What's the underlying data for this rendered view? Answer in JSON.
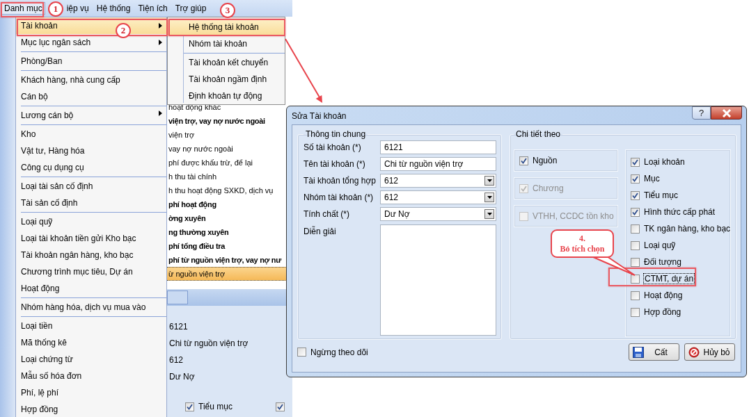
{
  "menubar": {
    "items": [
      {
        "label": "Danh mục",
        "selected": true
      },
      {
        "label": "iệp vụ",
        "selected": false
      },
      {
        "label": "Hệ thống",
        "selected": false
      },
      {
        "label": "Tiện ích",
        "selected": false
      },
      {
        "label": "Trợ giúp",
        "selected": false
      }
    ]
  },
  "menu": {
    "items": [
      {
        "label": "Tài khoản",
        "selected": true,
        "has_submenu": true,
        "separator_before": false
      },
      {
        "label": "Mục lục ngân sách",
        "selected": false,
        "has_submenu": true,
        "separator_before": false
      },
      {
        "label": "Phòng/Ban",
        "selected": false,
        "has_submenu": false,
        "separator_before": true
      },
      {
        "label": "Khách hàng, nhà cung cấp",
        "selected": false,
        "has_submenu": false,
        "separator_before": true
      },
      {
        "label": "Cán bộ",
        "selected": false,
        "has_submenu": false,
        "separator_before": false
      },
      {
        "label": "Lương cán bộ",
        "selected": false,
        "has_submenu": true,
        "separator_before": true
      },
      {
        "label": "Kho",
        "selected": false,
        "has_submenu": false,
        "separator_before": true
      },
      {
        "label": "Vật tư, Hàng hóa",
        "selected": false,
        "has_submenu": false,
        "separator_before": false
      },
      {
        "label": "Công cụ dụng cụ",
        "selected": false,
        "has_submenu": false,
        "separator_before": false
      },
      {
        "label": "Loại tài sản cố định",
        "selected": false,
        "has_submenu": false,
        "separator_before": true
      },
      {
        "label": "Tài sản cố định",
        "selected": false,
        "has_submenu": false,
        "separator_before": false
      },
      {
        "label": "Loại quỹ",
        "selected": false,
        "has_submenu": false,
        "separator_before": true
      },
      {
        "label": "Loại tài khoản tiền gửi Kho bạc",
        "selected": false,
        "has_submenu": false,
        "separator_before": false
      },
      {
        "label": "Tài khoản ngân hàng, kho bạc",
        "selected": false,
        "has_submenu": false,
        "separator_before": false
      },
      {
        "label": "Chương trình mục tiêu, Dự án",
        "selected": false,
        "has_submenu": false,
        "separator_before": false
      },
      {
        "label": "Hoạt động",
        "selected": false,
        "has_submenu": false,
        "separator_before": false
      },
      {
        "label": "Nhóm hàng hóa, dịch vụ mua vào",
        "selected": false,
        "has_submenu": false,
        "separator_before": true
      },
      {
        "label": "Loại tiền",
        "selected": false,
        "has_submenu": false,
        "separator_before": true
      },
      {
        "label": "Mã thống kê",
        "selected": false,
        "has_submenu": false,
        "separator_before": false
      },
      {
        "label": "Loại chứng từ",
        "selected": false,
        "has_submenu": false,
        "separator_before": false
      },
      {
        "label": "Mẫu số hóa đơn",
        "selected": false,
        "has_submenu": false,
        "separator_before": false
      },
      {
        "label": "Phí, lệ phí",
        "selected": false,
        "has_submenu": false,
        "separator_before": false
      },
      {
        "label": "Hợp đồng",
        "selected": false,
        "has_submenu": false,
        "separator_before": false
      }
    ]
  },
  "submenu": {
    "items": [
      {
        "label": "Hệ thống tài khoản",
        "selected": true,
        "separator_before": false
      },
      {
        "label": "Nhóm tài khoản",
        "selected": false,
        "separator_before": false
      },
      {
        "label": "Tài khoản kết chuyển",
        "selected": false,
        "separator_before": true
      },
      {
        "label": "Tài khoản ngầm định",
        "selected": false,
        "separator_before": false
      },
      {
        "label": "Định khoản tự động",
        "selected": false,
        "separator_before": false
      }
    ]
  },
  "account_list": {
    "rows": [
      {
        "text": "hoạt động khác",
        "bold": false,
        "selected": false
      },
      {
        "text": "viện trợ, vay nợ nước ngoài",
        "bold": true,
        "selected": false
      },
      {
        "text": "viện trợ",
        "bold": false,
        "selected": false
      },
      {
        "text": "vay nợ nước ngoài",
        "bold": false,
        "selected": false
      },
      {
        "text": "phí được khấu trừ, để lại",
        "bold": false,
        "selected": false
      },
      {
        "text": "h thu tài chính",
        "bold": false,
        "selected": false
      },
      {
        "text": "h thu hoạt động SXKD, dịch vụ",
        "bold": false,
        "selected": false
      },
      {
        "text": "phí hoạt động",
        "bold": true,
        "selected": false
      },
      {
        "text": "ờng xuyên",
        "bold": true,
        "selected": false
      },
      {
        "text": "ng thường xuyên",
        "bold": true,
        "selected": false
      },
      {
        "text": "phí tổng điều tra",
        "bold": true,
        "selected": false
      },
      {
        "text": "phí từ nguồn viện trợ, vay nợ nư",
        "bold": true,
        "selected": false
      },
      {
        "text": "ừ nguồn viện trợ",
        "bold": false,
        "selected": true
      }
    ]
  },
  "detail_panel": {
    "values": [
      "6121",
      "Chi từ nguồn viện trợ",
      "612",
      "Dư Nợ"
    ],
    "checkboxes": [
      {
        "label": "Tiểu mục",
        "checked": true
      },
      {
        "checked": true
      }
    ]
  },
  "dialog": {
    "title": "Sửa Tài khoản",
    "help_button": "?",
    "general": {
      "title": "Thông tin chung",
      "fields": [
        {
          "label": "Số tài khoản (*)",
          "value": "6121",
          "kind": "text"
        },
        {
          "label": "Tên tài khoản (*)",
          "value": "Chi từ nguồn viện trợ",
          "kind": "text"
        },
        {
          "label": "Tài khoản tổng hợp",
          "value": "612",
          "kind": "combo"
        },
        {
          "label": "Nhóm tài khoản (*)",
          "value": "612",
          "kind": "combo"
        },
        {
          "label": "Tính chất (*)",
          "value": "Dư Nợ",
          "kind": "combo"
        },
        {
          "label": "Diễn giải",
          "kind": "textarea"
        }
      ]
    },
    "details": {
      "title": "Chi tiết theo",
      "left_options": [
        {
          "label": "Nguồn",
          "checked": true,
          "disabled": false
        },
        {
          "label": "Chương",
          "checked": true,
          "disabled": true
        },
        {
          "label": "VTHH, CCDC tồn kho",
          "checked": false,
          "disabled": true
        }
      ],
      "right_options": [
        {
          "label": "Loại khoản",
          "checked": true,
          "focused": false
        },
        {
          "label": "Mục",
          "checked": true,
          "focused": false
        },
        {
          "label": "Tiểu mục",
          "checked": true,
          "focused": false
        },
        {
          "label": "Hình thức cấp phát",
          "checked": true,
          "focused": false
        },
        {
          "label": "TK ngân hàng, kho bạc",
          "checked": false,
          "focused": false
        },
        {
          "label": "Loại quỹ",
          "checked": false,
          "focused": false
        },
        {
          "label": "Đối tượng",
          "checked": false,
          "focused": false
        },
        {
          "label": "CTMT, dự án",
          "checked": false,
          "focused": true
        },
        {
          "label": "Hoạt động",
          "checked": false,
          "focused": false
        },
        {
          "label": "Hợp đồng",
          "checked": false,
          "focused": false
        }
      ]
    },
    "stop_tracking": {
      "label": "Ngừng theo dõi",
      "checked": false
    },
    "buttons": [
      {
        "label": "Cất",
        "kind": "save"
      },
      {
        "label": "Hủy bỏ",
        "kind": "cancel"
      }
    ]
  },
  "annotations": {
    "markers": [
      {
        "label": "1"
      },
      {
        "label": "2"
      },
      {
        "label": "3"
      }
    ],
    "callout": {
      "number": "4.",
      "text": "Bỏ tích chọn"
    }
  }
}
